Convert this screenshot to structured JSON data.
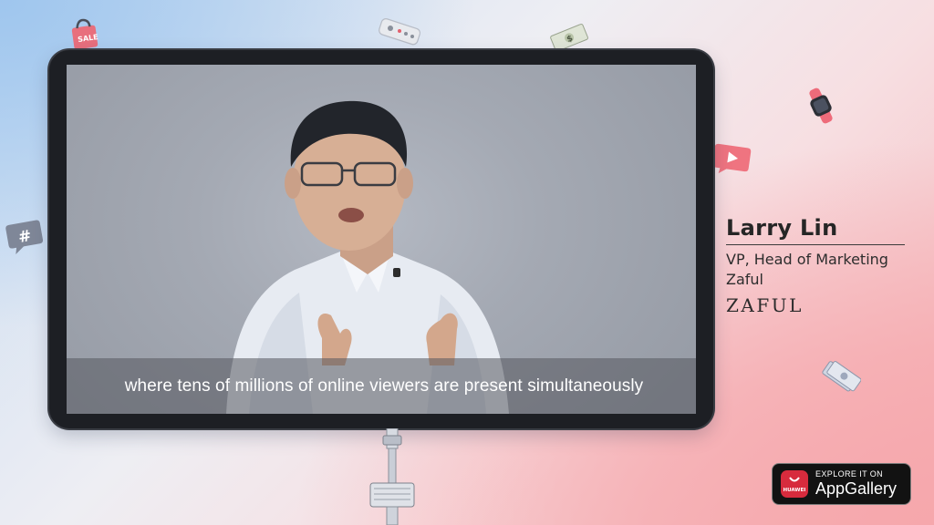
{
  "video": {
    "subtitle": "where tens of millions of online viewers are present simultaneously"
  },
  "speaker": {
    "name": "Larry Lin",
    "role": "VP, Head of Marketing",
    "company": "Zaful",
    "company_logo_text": "ZAFUL"
  },
  "badge": {
    "small_text": "EXPLORE IT ON",
    "large_text": "AppGallery",
    "logo_text": "HUAWEI"
  },
  "stickers": [
    {
      "icon": "shopping-bag-icon"
    },
    {
      "icon": "remote-control-icon"
    },
    {
      "icon": "dollar-bill-icon"
    },
    {
      "icon": "smartwatch-icon"
    },
    {
      "icon": "play-button-icon"
    },
    {
      "icon": "hashtag-bubble-icon"
    },
    {
      "icon": "money-bills-icon"
    }
  ],
  "colors": {
    "background_blue": "#9fc6ee",
    "background_pink": "#f6a7ac",
    "tablet_frame": "#1d1f24",
    "subtitle_bar": "#55575e",
    "badge_bg": "#121212",
    "huawei_red": "#d72b3d"
  }
}
